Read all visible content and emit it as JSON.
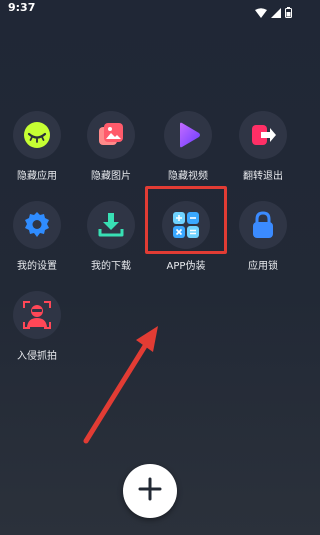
{
  "status": {
    "time": "9:37",
    "icons": [
      "wifi-icon",
      "signal-icon",
      "battery-icon"
    ]
  },
  "apps": [
    {
      "label": "隐藏应用",
      "icon": "eye-closed-icon",
      "color": "#c9ff3c"
    },
    {
      "label": "隐藏图片",
      "icon": "photo-icon",
      "color": "#ff6a6a"
    },
    {
      "label": "隐藏视频",
      "icon": "play-icon",
      "color": "#9b5cff"
    },
    {
      "label": "翻转退出",
      "icon": "exit-icon",
      "color": "#ff3d6b"
    },
    {
      "label": "我的设置",
      "icon": "gear-icon",
      "color": "#3aa0ff"
    },
    {
      "label": "我的下载",
      "icon": "download-icon",
      "color": "#35d6b0"
    },
    {
      "label": "APP伪装",
      "icon": "calculator-icon",
      "color": "#6fd3ff"
    },
    {
      "label": "应用锁",
      "icon": "lock-icon",
      "color": "#3b8bff"
    },
    {
      "label": "入侵抓拍",
      "icon": "intruder-icon",
      "color": "#ff4757"
    }
  ],
  "fab": {
    "icon": "plus-icon"
  },
  "annotation": {
    "highlight_color": "#e23c34",
    "arrow_color": "#e23c34"
  }
}
